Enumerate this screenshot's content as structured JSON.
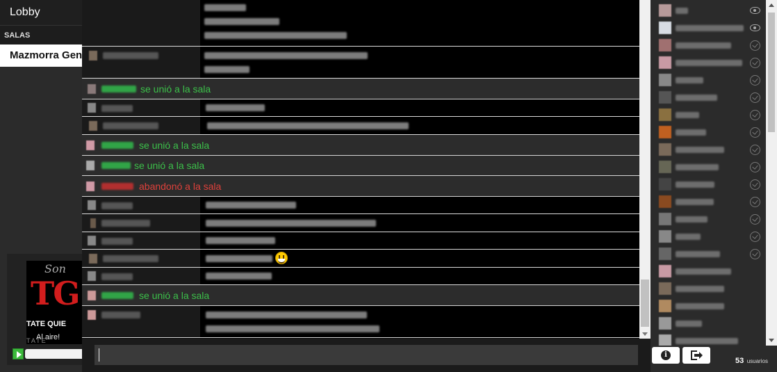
{
  "sidebar": {
    "lobby_label": "Lobby",
    "section_label": "SALAS",
    "rooms": [
      {
        "label": "Mazmorra Gene"
      }
    ],
    "player": {
      "top_text": "Son",
      "logo_text": "TG",
      "title": "TATE QUIE",
      "subtitle": "Al aire!",
      "bottom_text": "TATE"
    }
  },
  "chat": {
    "events": [
      {
        "text": "se unió a la sala",
        "type": "join"
      },
      {
        "text": "se unió a la sala",
        "type": "join"
      },
      {
        "text": "se unió a la sala",
        "type": "join"
      },
      {
        "text": "abandonó a la sala",
        "type": "leave"
      },
      {
        "text": "se unió a la sala",
        "type": "join"
      }
    ],
    "emoji": "smiley-emoji",
    "input_placeholder": ""
  },
  "users_panel": {
    "count": "53",
    "count_label": "usuarios",
    "info_icon": "i"
  },
  "colors": {
    "join": "#3cc04a",
    "leave": "#e0413b",
    "background": "#000000"
  }
}
